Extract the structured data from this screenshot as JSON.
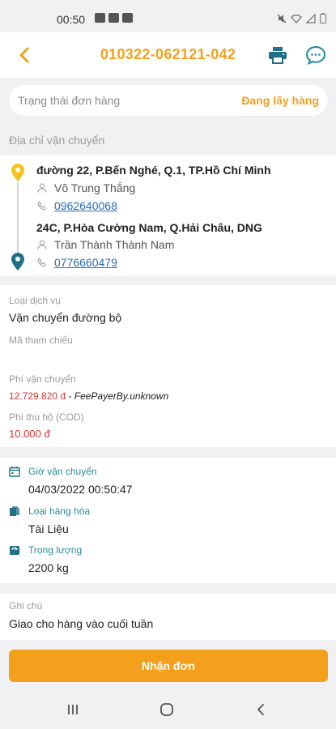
{
  "status_bar": {
    "time": "00:50"
  },
  "header": {
    "order_code": "010322-062121-042",
    "icons": {
      "back": "chevron-left-icon",
      "print": "printer-icon",
      "chat": "chat-bubble-icon"
    }
  },
  "order_status": {
    "label": "Trạng thái đơn hàng",
    "value": "Đang lấy hàng"
  },
  "shipping": {
    "section_title": "Địa chỉ vận chuyển",
    "sender": {
      "address": "đường 22, P.Bến Nghé, Q.1, TP.Hồ Chí Minh",
      "name": "Võ Trung Thắng",
      "phone": "0962640068"
    },
    "receiver": {
      "address": "24C, P.Hòa Cường Nam, Q.Hải Châu, DNG",
      "name": "Trần Thành Thành Nam",
      "phone": "0776660479"
    }
  },
  "service": {
    "service_type_label": "Loại dịch vụ",
    "service_type_value": "Vận chuyển đường bộ",
    "reference_label": "Mã tham chiếu",
    "shipping_fee_label": "Phí vận chuyển",
    "shipping_fee_amount": "12.729.820 đ",
    "shipping_fee_payer": " - FeePayerBy.unknown",
    "cod_label": "Phí thu hộ (COD)",
    "cod_amount": "10.000 đ"
  },
  "details": {
    "time_label": "Giờ vận chuyển",
    "time_value": "04/03/2022 00:50:47",
    "goods_label": "Loại hàng hóa",
    "goods_value": "Tài Liệu",
    "weight_label": "Trọng lượng",
    "weight_value": "2200 kg"
  },
  "note": {
    "label": "Ghi chú",
    "value": "Giao cho hàng vào cuối tuần"
  },
  "actions": {
    "accept_label": "Nhận đơn"
  },
  "colors": {
    "accent": "#f4a01c",
    "teal": "#2a8a9e",
    "danger": "#d33333",
    "link": "#2a6ab6",
    "pin_sender": "#f4c21c"
  }
}
